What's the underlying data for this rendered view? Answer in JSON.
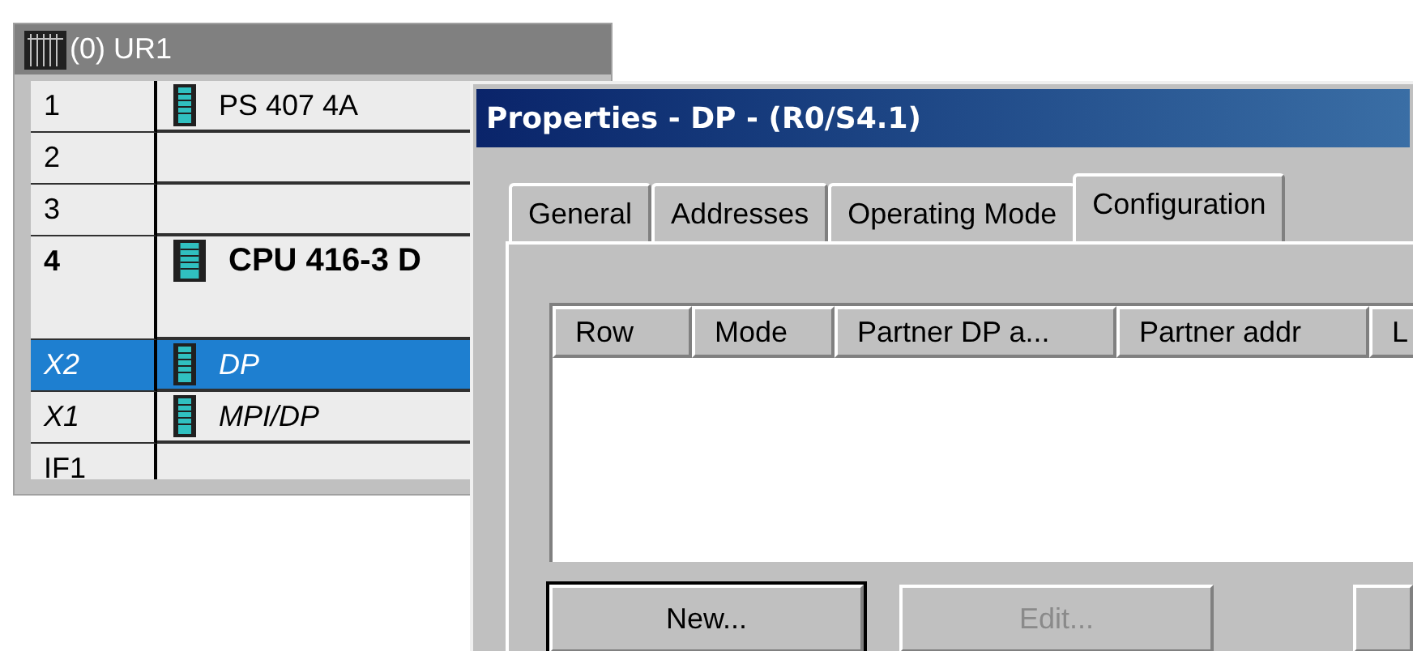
{
  "rack_window": {
    "title": "(0) UR1",
    "rows": [
      {
        "slot": "1",
        "module": "PS 407 4A",
        "kind": "module",
        "selected": false,
        "tall": false
      },
      {
        "slot": "2",
        "kind": "empty",
        "selected": false,
        "tall": false
      },
      {
        "slot": "3",
        "kind": "empty",
        "selected": false,
        "tall": false
      },
      {
        "slot": "4",
        "module": "CPU 416-3 D",
        "kind": "cpu",
        "selected": false,
        "tall": true
      },
      {
        "slot": "X2",
        "module": "DP",
        "kind": "interface",
        "selected": true,
        "tall": false
      },
      {
        "slot": "X1",
        "module": "MPI/DP",
        "kind": "interface",
        "selected": false,
        "tall": false
      },
      {
        "slot": "IF1",
        "kind": "empty",
        "selected": false,
        "tall": false
      }
    ]
  },
  "dialog": {
    "title": "Properties - DP - (R0/S4.1)",
    "tabs": [
      {
        "label": "General",
        "selected": false
      },
      {
        "label": "Addresses",
        "selected": false
      },
      {
        "label": "Operating Mode",
        "selected": false
      },
      {
        "label": "Configuration",
        "selected": true
      }
    ],
    "table": {
      "columns": [
        "Row",
        "Mode",
        "Partner DP a...",
        "Partner addr",
        "L"
      ]
    },
    "buttons": [
      {
        "kind": "full",
        "label": "New...",
        "disabled": false,
        "default": true
      },
      {
        "kind": "full",
        "label": "Edit...",
        "disabled": true,
        "default": false
      },
      {
        "kind": "partial"
      }
    ]
  }
}
